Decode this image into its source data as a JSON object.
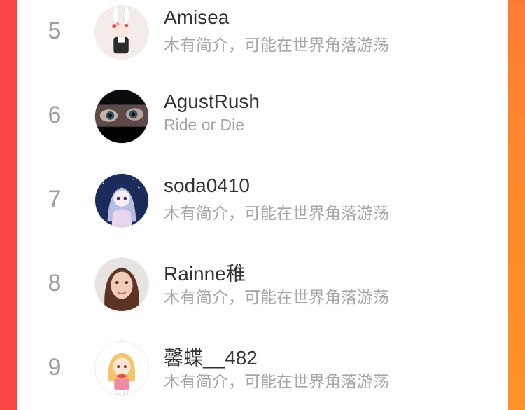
{
  "rows": [
    {
      "rank": "5",
      "name": "Amisea",
      "bio": "木有简介，可能在世界角落游荡",
      "avatar_icon": "bunny-girl-avatar-icon"
    },
    {
      "rank": "6",
      "name": "AgustRush",
      "bio": "Ride or Die",
      "avatar_icon": "eyes-closeup-avatar-icon"
    },
    {
      "rank": "7",
      "name": "soda0410",
      "bio": "木有简介，可能在世界角落游荡",
      "avatar_icon": "anime-girl-avatar-icon"
    },
    {
      "rank": "8",
      "name": "Rainne稚",
      "bio": "木有简介，可能在世界角落游荡",
      "avatar_icon": "portrait-girl-avatar-icon"
    },
    {
      "rank": "9",
      "name": "馨蝶__482",
      "bio": "木有简介，可能在世界角落游荡",
      "avatar_icon": "cartoon-girl-avatar-icon"
    }
  ],
  "colors": {
    "rank": "#9e9e9e",
    "name": "#333333",
    "bio": "#a6a6a6",
    "accent_left": "#fa4545",
    "accent_right": "#ff8a2a"
  }
}
